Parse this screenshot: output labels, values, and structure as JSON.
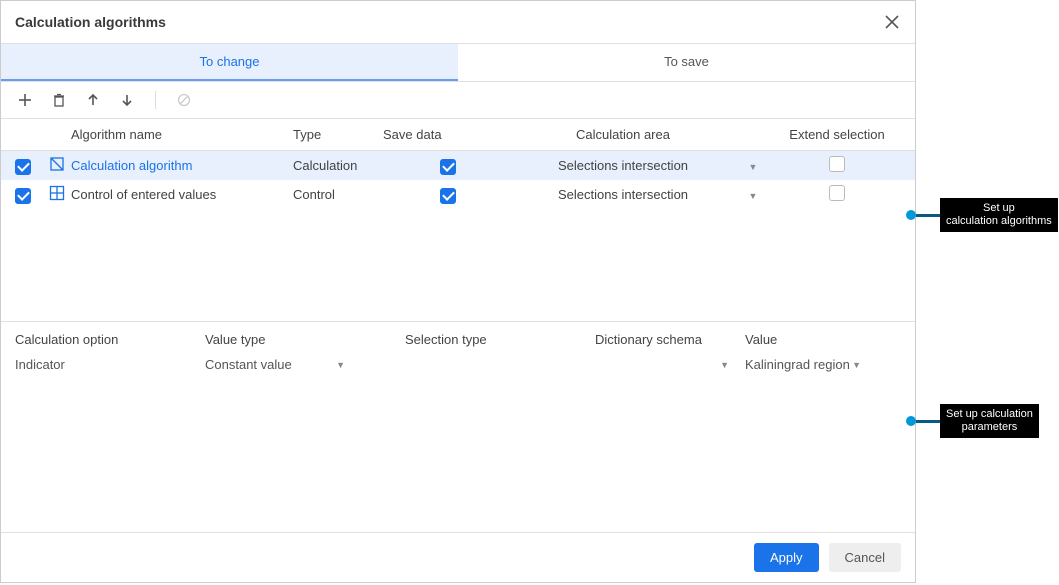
{
  "dialog": {
    "title": "Calculation algorithms"
  },
  "tabs": {
    "change": "To change",
    "save": "To save"
  },
  "gridHead": {
    "name": "Algorithm name",
    "type": "Type",
    "save": "Save data",
    "area": "Calculation area",
    "ext": "Extend selection"
  },
  "rows": [
    {
      "name": "Calculation algorithm",
      "type": "Calculation",
      "area": "Selections intersection"
    },
    {
      "name": "Control of entered values",
      "type": "Control",
      "area": "Selections intersection"
    }
  ],
  "lower": {
    "head": {
      "opt": "Calculation option",
      "vtype": "Value type",
      "sel": "Selection type",
      "dict": "Dictionary schema",
      "val": "Value"
    },
    "row": {
      "opt": "Indicator",
      "vtype": "Constant value",
      "val": "Kaliningrad region"
    }
  },
  "footer": {
    "apply": "Apply",
    "cancel": "Cancel"
  },
  "callouts": {
    "top": {
      "l1": "Set up",
      "l2": "calculation algorithms"
    },
    "bottom": {
      "l1": "Set up calculation",
      "l2": "parameters"
    }
  }
}
